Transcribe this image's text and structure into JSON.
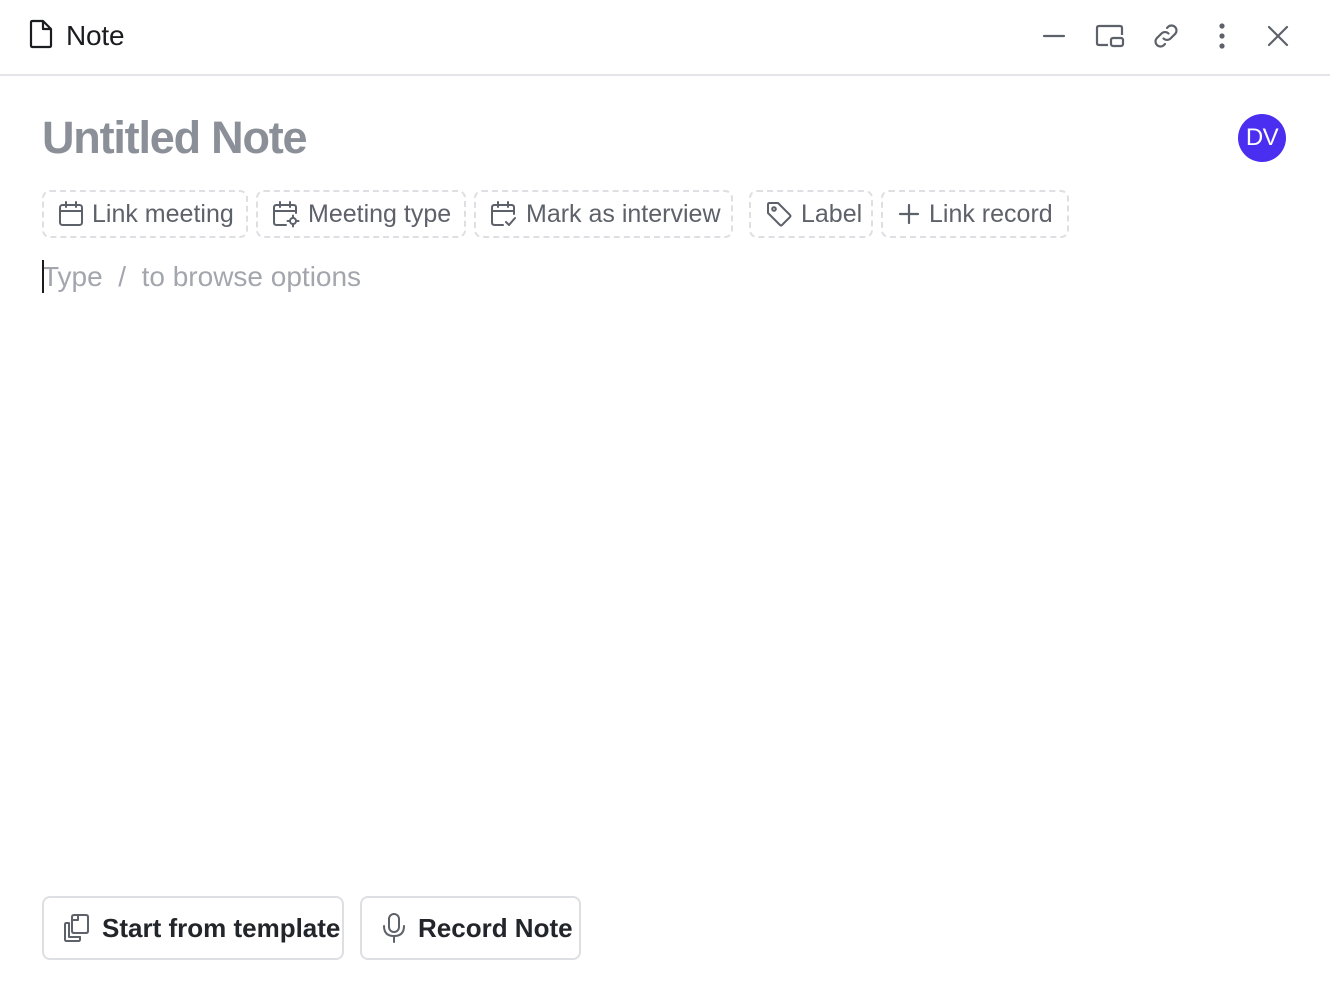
{
  "header": {
    "title": "Note",
    "icons": [
      "file-icon",
      "minimize-icon",
      "picture-in-picture-icon",
      "link-icon",
      "more-vertical-icon",
      "close-icon"
    ]
  },
  "note": {
    "title": "Untitled Note",
    "avatar_initials": "DV",
    "avatar_color": "#4a2ff0"
  },
  "chips": [
    {
      "label": "Link meeting",
      "icon": "calendar-icon"
    },
    {
      "label": "Meeting type",
      "icon": "calendar-settings-icon"
    },
    {
      "label": "Mark as interview",
      "icon": "calendar-check-icon"
    },
    {
      "label": "Label",
      "icon": "tag-icon"
    },
    {
      "label": "Link record",
      "icon": "plus-icon"
    }
  ],
  "editor": {
    "placeholder": "Type  /  to browse options"
  },
  "actions": {
    "template_label": "Start from template",
    "record_label": "Record Note"
  }
}
